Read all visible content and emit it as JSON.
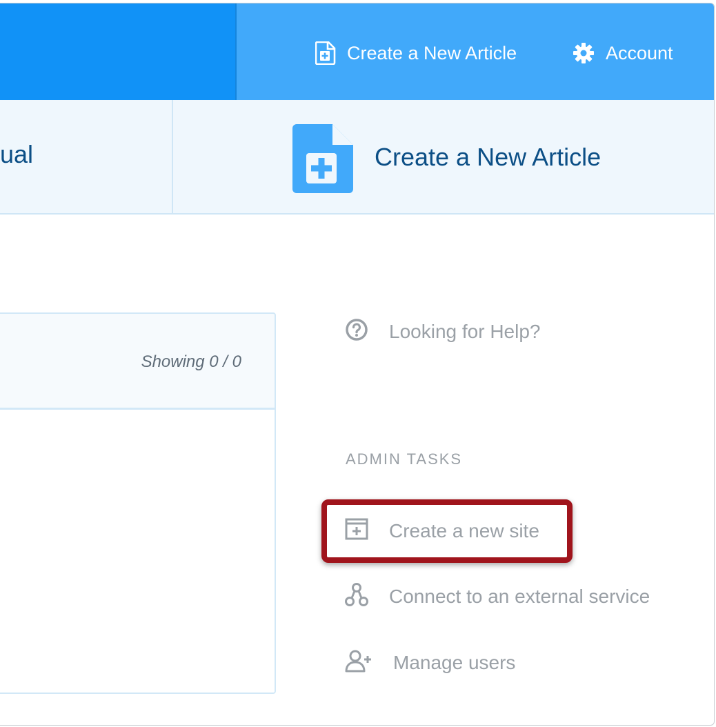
{
  "topbar": {
    "create_article": "Create a New Article",
    "account": "Account"
  },
  "tabs": {
    "left_partial_label": "ual",
    "create_article": "Create a New Article"
  },
  "panel": {
    "showing": "Showing 0 / 0"
  },
  "sidebar": {
    "help": "Looking for Help?",
    "admin_heading": "ADMIN TASKS",
    "items": [
      {
        "label": "Create a new site",
        "icon": "site-add-icon"
      },
      {
        "label": "Connect to an external service",
        "icon": "connect-icon"
      },
      {
        "label": "Manage users",
        "icon": "user-add-icon"
      }
    ]
  },
  "colors": {
    "topbar_primary": "#1192f7",
    "topbar_secondary": "#41a9fa",
    "tab_text": "#0c4f86",
    "sidebar_text": "#9aa0a6",
    "highlight": "#a0141c"
  }
}
